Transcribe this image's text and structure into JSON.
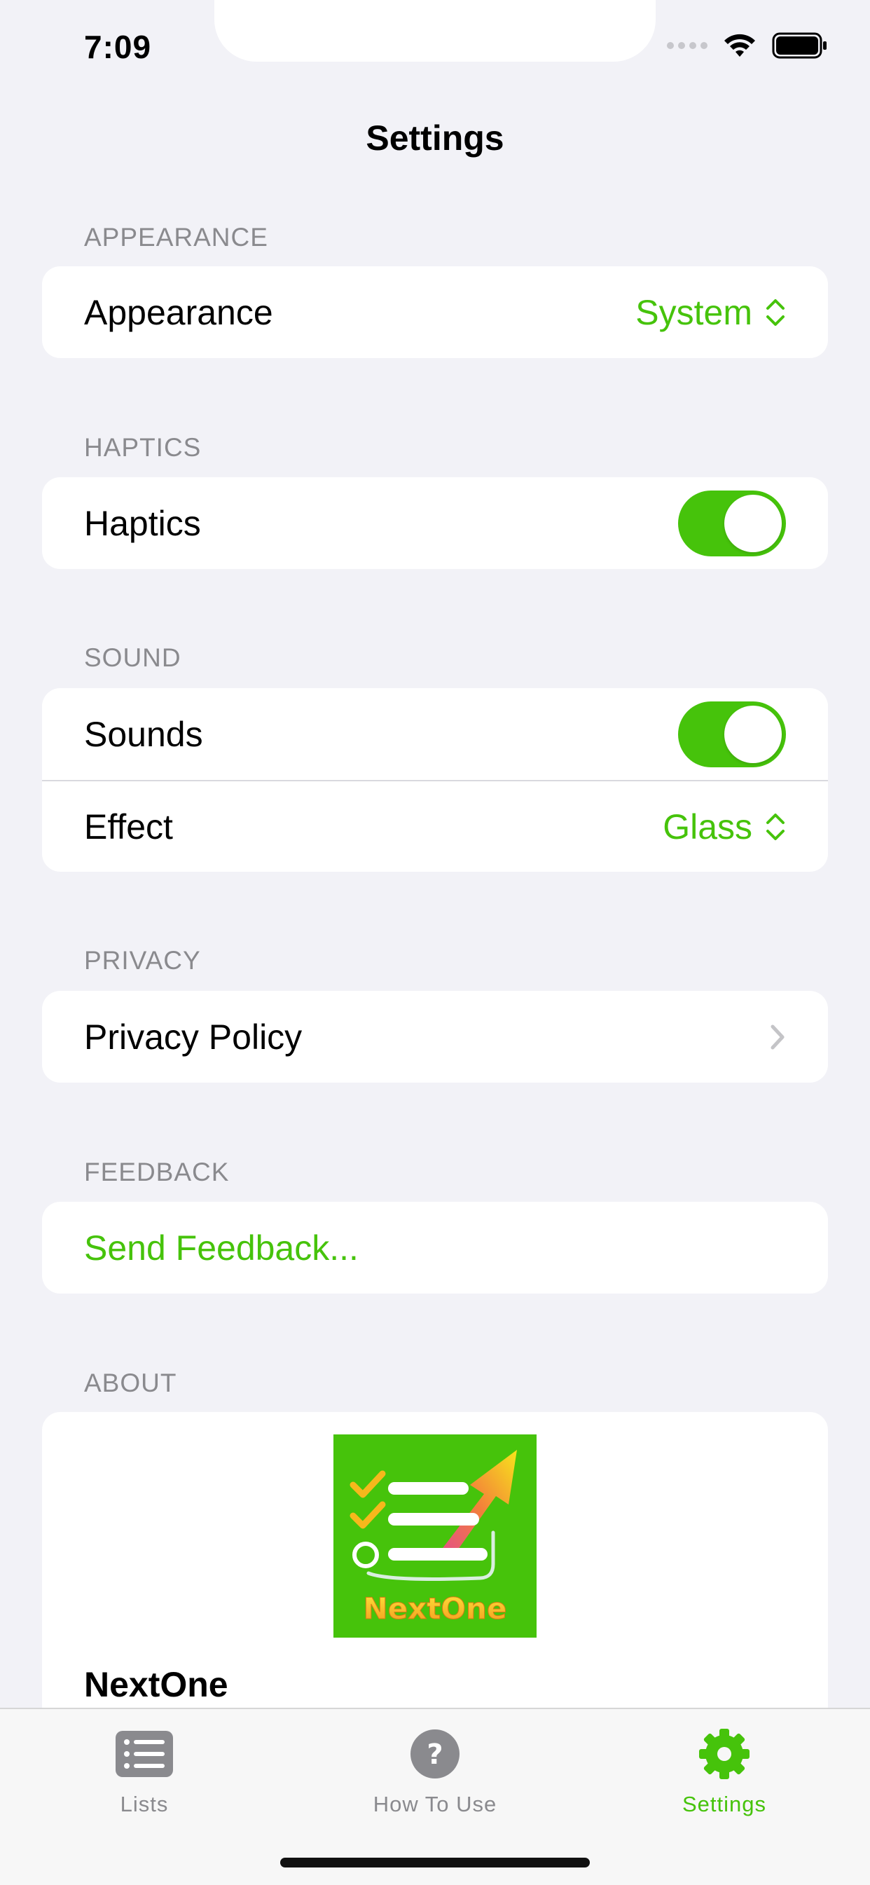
{
  "status_bar": {
    "time": "7:09"
  },
  "nav": {
    "title": "Settings"
  },
  "sections": {
    "appearance": {
      "header": "APPEARANCE",
      "row_label": "Appearance",
      "row_value": "System"
    },
    "haptics": {
      "header": "HAPTICS",
      "row_label": "Haptics",
      "toggle_on": true
    },
    "sound": {
      "header": "SOUND",
      "sounds_label": "Sounds",
      "sounds_on": true,
      "effect_label": "Effect",
      "effect_value": "Glass"
    },
    "privacy": {
      "header": "PRIVACY",
      "row_label": "Privacy Policy"
    },
    "feedback": {
      "header": "FEEDBACK",
      "row_label": "Send Feedback..."
    },
    "about": {
      "header": "ABOUT",
      "logo_text": "NextOne",
      "app_name": "NextOne"
    }
  },
  "tabbar": {
    "tabs": [
      {
        "label": "Lists",
        "icon": "list-icon",
        "active": false
      },
      {
        "label": "How To Use",
        "icon": "question-icon",
        "active": false
      },
      {
        "label": "Settings",
        "icon": "gear-icon",
        "active": true
      }
    ]
  },
  "colors": {
    "accent": "#46c30b",
    "background": "#f2f2f7",
    "secondary_text": "#8a8a8e"
  }
}
